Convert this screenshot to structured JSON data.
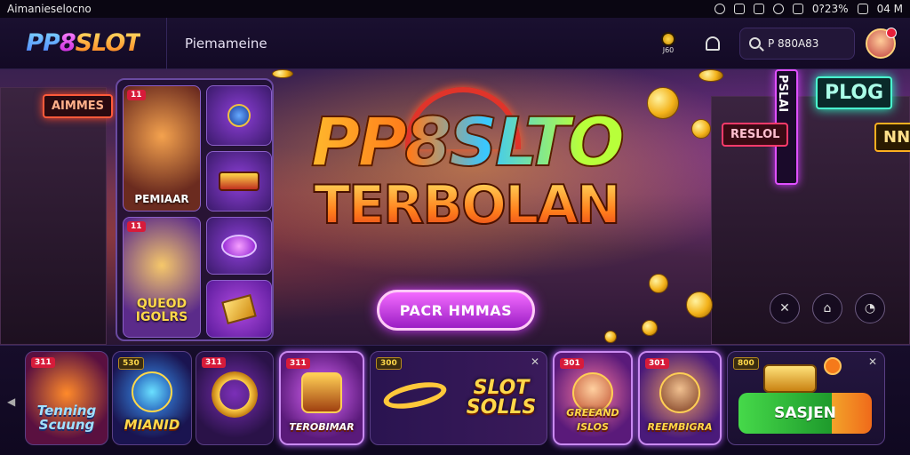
{
  "statusbar": {
    "left_text": "Aimanieselocno",
    "right_text": "0?23%",
    "time": "04 M"
  },
  "header": {
    "logo_pp": "PP",
    "logo_8": "8",
    "logo_slot": "SLOT",
    "nav_title": "Piemameine",
    "trophy_label": "J60",
    "search_text": "P 880A83"
  },
  "hero": {
    "title": "PP8SLTO",
    "subtitle": "TERBOLAN",
    "cta_label": "PACR HMMAS",
    "panel": {
      "tile1_badge": "11",
      "tile1_caption": "PEMIAAR",
      "tile2_badge": "11",
      "tile2_caption": "QUEOD IGOLRS"
    },
    "signs": [
      "AIMMES",
      "PLOG",
      "PSLAI",
      "RESLOL",
      "NN"
    ]
  },
  "games": [
    {
      "badge": "311",
      "title": "Tenning Scuung"
    },
    {
      "badge": "530",
      "title": "MIANID"
    },
    {
      "badge": "311",
      "title": ""
    },
    {
      "badge": "311",
      "title": "TEROBIMAR"
    },
    {
      "badge": "300",
      "title": "SLOT SOLLS"
    },
    {
      "badge": "301",
      "title": "GREEAND ISLOS"
    },
    {
      "badge": "301",
      "title": "REEMBIGRA"
    },
    {
      "badge": "800",
      "title": "SASJEN"
    }
  ],
  "colors": {
    "accent_pink": "#d03cff",
    "badge_red": "#d71b3a",
    "gold": "#ffd84a",
    "green": "#46d94a"
  }
}
